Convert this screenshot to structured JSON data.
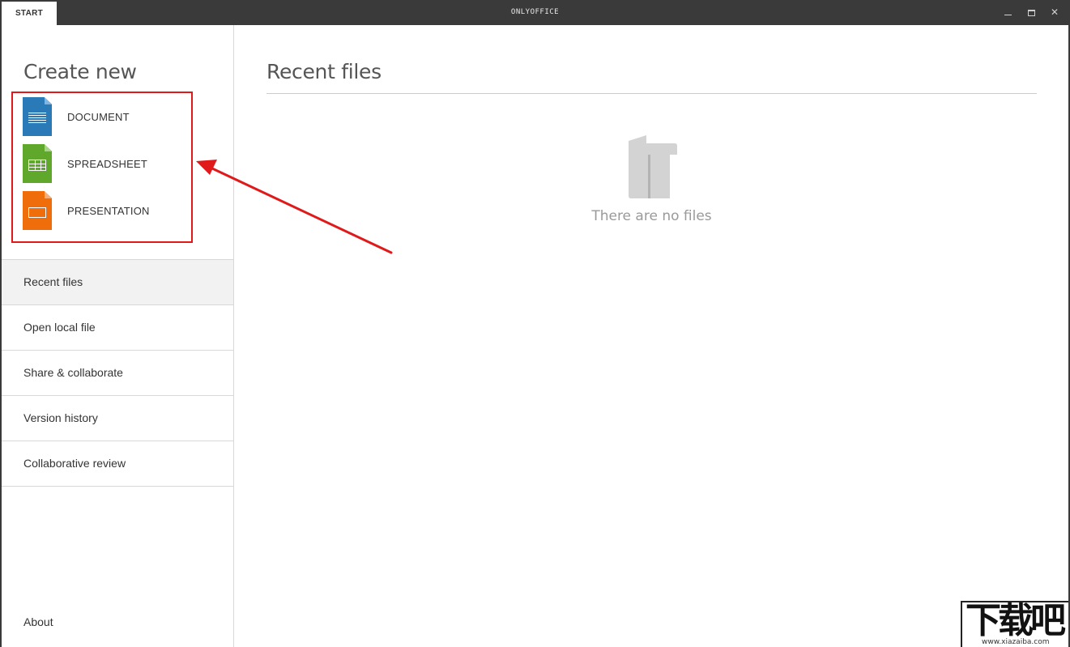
{
  "titlebar": {
    "tab_label": "START",
    "app_title": "ONLYOFFICE",
    "minimize_icon": "minimize-icon",
    "maximize_icon": "maximize-icon",
    "close_icon": "close-icon",
    "close_glyph": "✕"
  },
  "sidebar": {
    "create_title": "Create new",
    "create_items": [
      {
        "label": "DOCUMENT",
        "icon": "document-file-icon",
        "color": "#2a7ab8"
      },
      {
        "label": "SPREADSHEET",
        "icon": "spreadsheet-file-icon",
        "color": "#5fa82c"
      },
      {
        "label": "PRESENTATION",
        "icon": "presentation-file-icon",
        "color": "#f06d0c"
      }
    ],
    "nav": [
      {
        "label": "Recent files",
        "active": true
      },
      {
        "label": "Open local file"
      },
      {
        "label": "Share & collaborate"
      },
      {
        "label": "Version history"
      },
      {
        "label": "Collaborative review"
      }
    ],
    "about": "About"
  },
  "main": {
    "title": "Recent files",
    "empty_text": "There are no files",
    "empty_icon": "empty-folder-icon"
  },
  "annotation": {
    "color": "#e01a1a"
  },
  "watermark": {
    "text": "下载吧",
    "url": "www.xiazaiba.com"
  }
}
